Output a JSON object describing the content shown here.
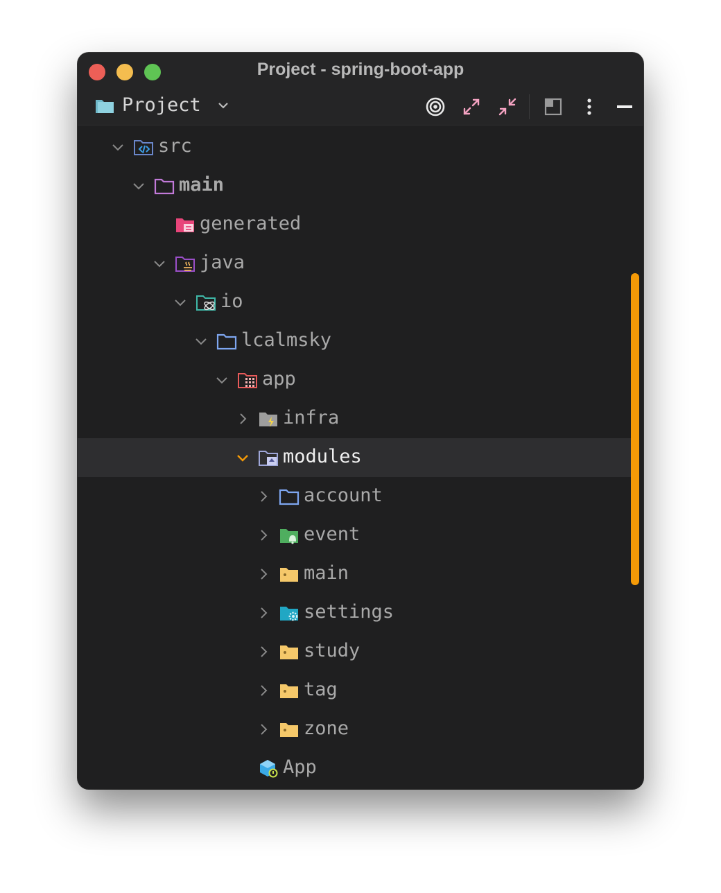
{
  "window": {
    "title": "Project - spring-boot-app"
  },
  "toolbar": {
    "view_label": "Project",
    "icons": [
      "locate-icon",
      "expand-all-icon",
      "collapse-all-icon",
      "layout-icon",
      "more-options-icon",
      "minimize-icon"
    ]
  },
  "colors": {
    "background": "#1f1f20",
    "selected_row": "#2e2e30",
    "scrollbar": "#f59a07",
    "accent_chevron": "#f59a07"
  },
  "tree": {
    "items": [
      {
        "label": "src",
        "depth": 0,
        "expanded": true,
        "icon": "source-folder-icon",
        "bold": false
      },
      {
        "label": "main",
        "depth": 1,
        "expanded": true,
        "icon": "folder-icon",
        "bold": true
      },
      {
        "label": "generated",
        "depth": 2,
        "expanded": null,
        "icon": "generated-folder-icon",
        "bold": false
      },
      {
        "label": "java",
        "depth": 2,
        "expanded": true,
        "icon": "java-folder-icon",
        "bold": false
      },
      {
        "label": "io",
        "depth": 3,
        "expanded": true,
        "icon": "package-folder-icon",
        "bold": false
      },
      {
        "label": "lcalmsky",
        "depth": 4,
        "expanded": true,
        "icon": "folder-icon",
        "bold": false
      },
      {
        "label": "app",
        "depth": 5,
        "expanded": true,
        "icon": "app-folder-icon",
        "bold": false
      },
      {
        "label": "infra",
        "depth": 6,
        "expanded": false,
        "icon": "infra-folder-icon",
        "bold": false
      },
      {
        "label": "modules",
        "depth": 6,
        "expanded": true,
        "icon": "modules-folder-icon",
        "bold": false,
        "selected": true
      },
      {
        "label": "account",
        "depth": 7,
        "expanded": false,
        "icon": "folder-icon",
        "bold": false
      },
      {
        "label": "event",
        "depth": 7,
        "expanded": false,
        "icon": "event-folder-icon",
        "bold": false
      },
      {
        "label": "main",
        "depth": 7,
        "expanded": false,
        "icon": "yellow-folder-icon",
        "bold": false
      },
      {
        "label": "settings",
        "depth": 7,
        "expanded": false,
        "icon": "settings-folder-icon",
        "bold": false
      },
      {
        "label": "study",
        "depth": 7,
        "expanded": false,
        "icon": "yellow-folder-icon",
        "bold": false
      },
      {
        "label": "tag",
        "depth": 7,
        "expanded": false,
        "icon": "yellow-folder-icon",
        "bold": false
      },
      {
        "label": "zone",
        "depth": 7,
        "expanded": false,
        "icon": "yellow-folder-icon",
        "bold": false
      },
      {
        "label": "App",
        "depth": 6,
        "expanded": null,
        "icon": "spring-app-class-icon",
        "bold": false
      }
    ]
  }
}
